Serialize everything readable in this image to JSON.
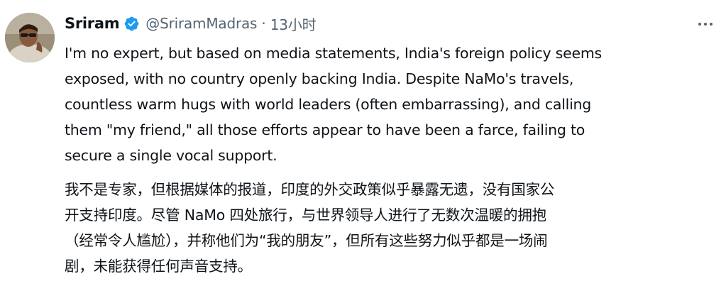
{
  "tweet": {
    "author_name": "Sriram",
    "handle": "@SriramMadras",
    "separator": "·",
    "time": "13小时",
    "verified_icon": "verified-badge-icon",
    "more_icon": "more-options-icon",
    "text_en_lines": [
      "I'm no expert, but based on media statements, India's foreign policy seems",
      "exposed, with no country openly backing India. Despite NaMo's travels,",
      "countless warm hugs with world leaders (often embarrassing), and calling",
      "them \"my friend,\" all those efforts appear to have been a farce, failing to",
      "secure a single vocal support."
    ],
    "text_zh_lines": [
      "我不是专家，但根据媒体的报道，印度的外交政策似乎暴露无遗，没有国家公",
      "开支持印度。尽管 NaMo 四处旅行，与世界领导人进行了无数次温暖的拥抱",
      "（经常令人尴尬），并称他们为“我的朋友”，但所有这些努力似乎都是一场闹",
      "剧，未能获得任何声音支持。"
    ]
  },
  "colors": {
    "text_primary": "#0f1419",
    "text_secondary": "#536471",
    "verified_blue": "#1d9bf0"
  }
}
